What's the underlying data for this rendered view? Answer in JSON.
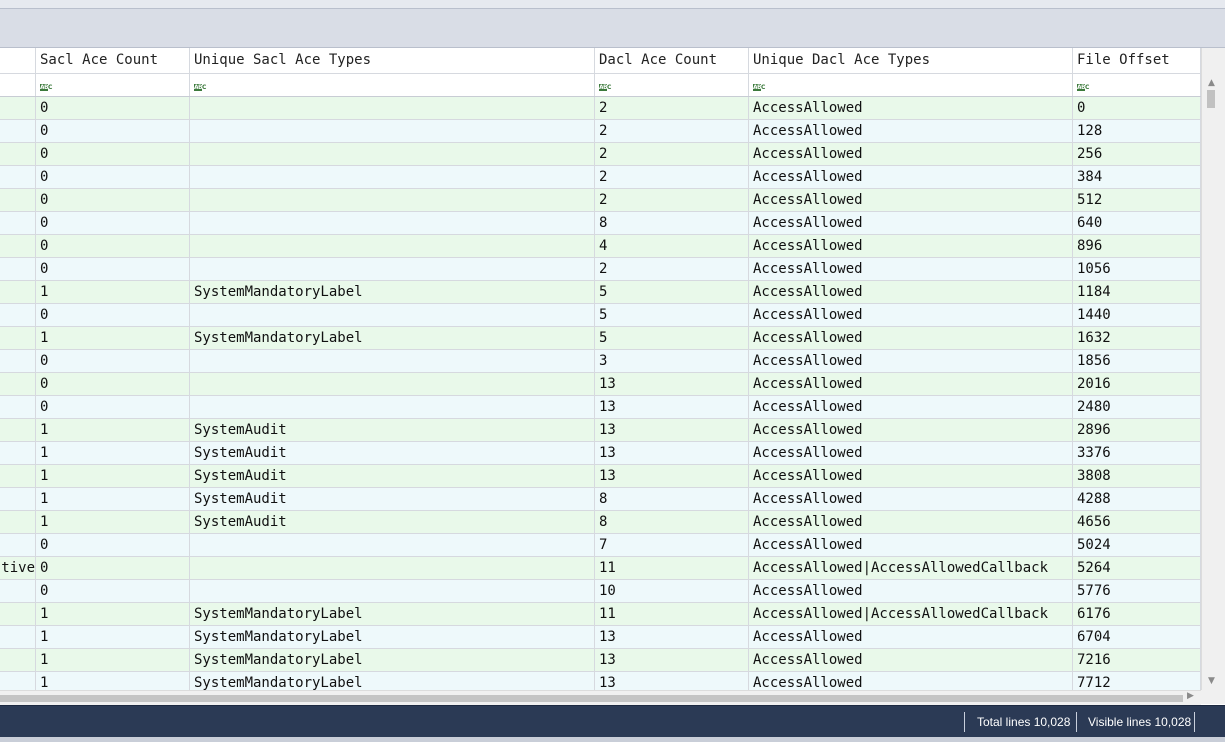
{
  "columns": [
    "",
    "Sacl Ace Count",
    "Unique Sacl Ace Types",
    "Dacl Ace Count",
    "Unique Dacl Ace Types",
    "File Offset"
  ],
  "rows": [
    [
      "",
      "0",
      "",
      "2",
      "AccessAllowed",
      "0"
    ],
    [
      "",
      "0",
      "",
      "2",
      "AccessAllowed",
      "128"
    ],
    [
      "",
      "0",
      "",
      "2",
      "AccessAllowed",
      "256"
    ],
    [
      "",
      "0",
      "",
      "2",
      "AccessAllowed",
      "384"
    ],
    [
      "",
      "0",
      "",
      "2",
      "AccessAllowed",
      "512"
    ],
    [
      "",
      "0",
      "",
      "8",
      "AccessAllowed",
      "640"
    ],
    [
      "",
      "0",
      "",
      "4",
      "AccessAllowed",
      "896"
    ],
    [
      "",
      "0",
      "",
      "2",
      "AccessAllowed",
      "1056"
    ],
    [
      "",
      "1",
      "SystemMandatoryLabel",
      "5",
      "AccessAllowed",
      "1184"
    ],
    [
      "",
      "0",
      "",
      "5",
      "AccessAllowed",
      "1440"
    ],
    [
      "",
      "1",
      "SystemMandatoryLabel",
      "5",
      "AccessAllowed",
      "1632"
    ],
    [
      "",
      "0",
      "",
      "3",
      "AccessAllowed",
      "1856"
    ],
    [
      "",
      "0",
      "",
      "13",
      "AccessAllowed",
      "2016"
    ],
    [
      "",
      "0",
      "",
      "13",
      "AccessAllowed",
      "2480"
    ],
    [
      "",
      "1",
      "SystemAudit",
      "13",
      "AccessAllowed",
      "2896"
    ],
    [
      "",
      "1",
      "SystemAudit",
      "13",
      "AccessAllowed",
      "3376"
    ],
    [
      "",
      "1",
      "SystemAudit",
      "13",
      "AccessAllowed",
      "3808"
    ],
    [
      "",
      "1",
      "SystemAudit",
      "8",
      "AccessAllowed",
      "4288"
    ],
    [
      "",
      "1",
      "SystemAudit",
      "8",
      "AccessAllowed",
      "4656"
    ],
    [
      "",
      "0",
      "",
      "7",
      "AccessAllowed",
      "5024"
    ],
    [
      "tive",
      "0",
      "",
      "11",
      "AccessAllowed|AccessAllowedCallback",
      "5264"
    ],
    [
      "",
      "0",
      "",
      "10",
      "AccessAllowed",
      "5776"
    ],
    [
      "",
      "1",
      "SystemMandatoryLabel",
      "11",
      "AccessAllowed|AccessAllowedCallback",
      "6176"
    ],
    [
      "",
      "1",
      "SystemMandatoryLabel",
      "13",
      "AccessAllowed",
      "6704"
    ],
    [
      "",
      "1",
      "SystemMandatoryLabel",
      "13",
      "AccessAllowed",
      "7216"
    ],
    [
      "",
      "1",
      "SystemMandatoryLabel",
      "13",
      "AccessAllowed",
      "7712"
    ]
  ],
  "status": {
    "total_lines": "Total lines 10,028",
    "visible_lines": "Visible lines 10,028"
  },
  "colors": {
    "row_even": "#e9f9ea",
    "row_odd": "#eef9fb",
    "status_bar": "#2b3a55"
  },
  "icons": {
    "filter": "abc-text-filter-icon"
  }
}
